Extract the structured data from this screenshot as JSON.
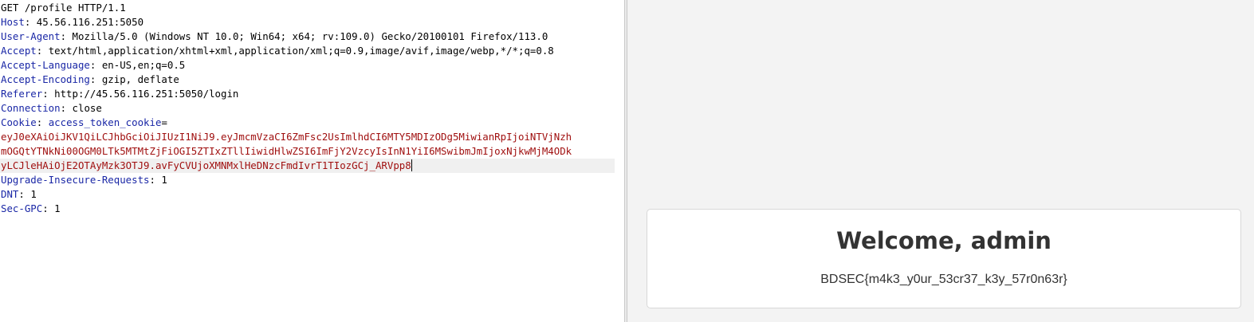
{
  "request": {
    "request_line": "GET /profile HTTP/1.1",
    "headers": [
      {
        "name": "Host",
        "value": "45.56.116.251:5050"
      },
      {
        "name": "User-Agent",
        "value": "Mozilla/5.0 (Windows NT 10.0; Win64; x64; rv:109.0) Gecko/20100101 Firefox/113.0"
      },
      {
        "name": "Accept",
        "value": "text/html,application/xhtml+xml,application/xml;q=0.9,image/avif,image/webp,*/*;q=0.8"
      },
      {
        "name": "Accept-Language",
        "value": "en-US,en;q=0.5"
      },
      {
        "name": "Accept-Encoding",
        "value": "gzip, deflate"
      },
      {
        "name": "Referer",
        "value": "http://45.56.116.251:5050/login"
      },
      {
        "name": "Connection",
        "value": "close"
      }
    ],
    "cookie": {
      "header_name": "Cookie",
      "cookie_name": "access_token_cookie",
      "value_lines": [
        "eyJ0eXAiOiJKV1QiLCJhbGciOiJIUzI1NiJ9.eyJmcmVzaCI6ZmFsc2UsImlhdCI6MTY5MDIzODg5MiwianRpIjoiNTVjNzh",
        "mOGQtYTNkNi00OGM0LTk5MTMtZjFiOGI5ZTIxZTllIiwidHlwZSI6ImFjY2VzcyIsInN1YiI6MSwibmJmIjoxNjkwMjM4ODk",
        "yLCJleHAiOjE2OTAyMzk3OTJ9.avFyCVUjoXMNMxlHeDNzcFmdIvrT1TIozGCj_ARVpp8"
      ]
    },
    "trailing_headers": [
      {
        "name": "Upgrade-Insecure-Requests",
        "value": "1"
      },
      {
        "name": "DNT",
        "value": "1"
      },
      {
        "name": "Sec-GPC",
        "value": "1"
      }
    ]
  },
  "response": {
    "title": "Welcome, admin",
    "flag": "BDSEC{m4k3_y0ur_53cr37_k3y_57r0n63r}"
  }
}
